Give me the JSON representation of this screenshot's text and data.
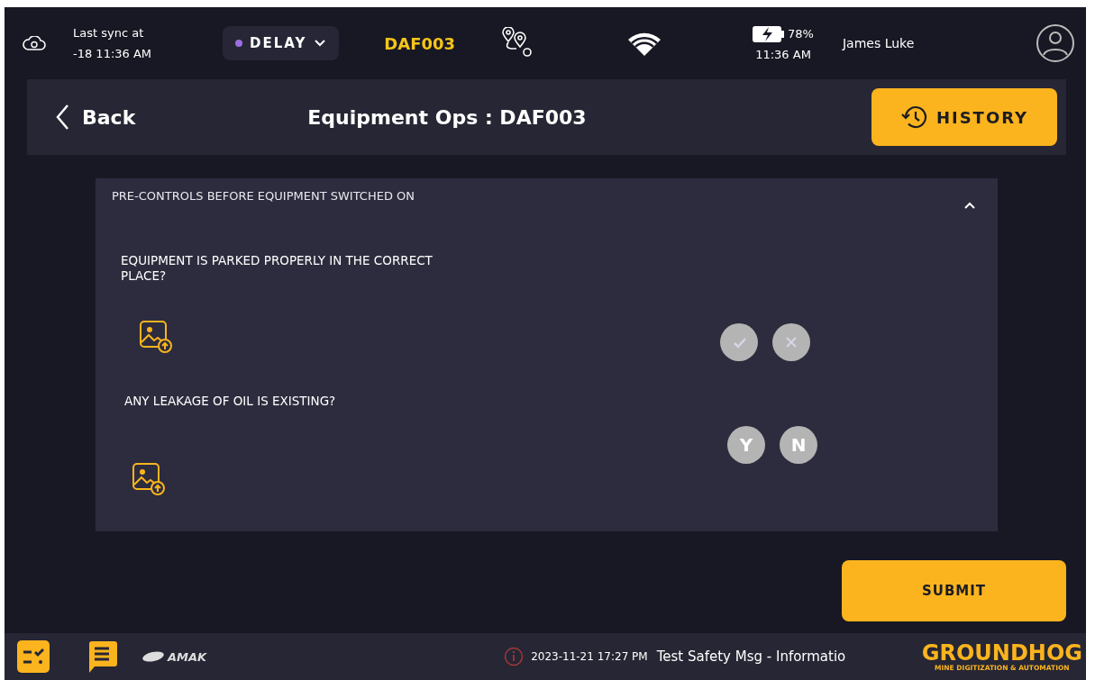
{
  "status_bar": {
    "sync_label": "Last sync at",
    "sync_time": "-18 11:36 AM",
    "status": {
      "label": "DELAY",
      "color": "#9b6fe0"
    },
    "equipment_id": "DAF003",
    "battery": "78%",
    "time": "11:36 AM",
    "user": "James Luke"
  },
  "header": {
    "back": "Back",
    "title": "Equipment Ops : DAF003",
    "history": "HISTORY"
  },
  "section": {
    "title": "PRE-CONTROLS BEFORE EQUIPMENT SWITCHED ON",
    "expanded": true,
    "questions": [
      {
        "text": "EQUIPMENT IS PARKED PROPERLY IN THE CORRECT PLACE?",
        "kind": "icons",
        "answers": [
          {
            "kind": "check",
            "selected": false
          },
          {
            "kind": "cross",
            "selected": false
          }
        ]
      },
      {
        "text": "ANY LEAKAGE OF OIL IS EXISTING?",
        "kind": "letters",
        "answers": [
          {
            "label": "Y",
            "selected": false
          },
          {
            "label": "N",
            "selected": false
          }
        ]
      }
    ]
  },
  "submit": "SUBMIT",
  "footer": {
    "partner_logo": "AMAK",
    "message_time": "2023-11-21 17:27 PM",
    "message": "Test Safety Msg - Informatio",
    "brand": "GROUNDHOG",
    "tagline": "MINE DIGITIZATION & AUTOMATION"
  }
}
